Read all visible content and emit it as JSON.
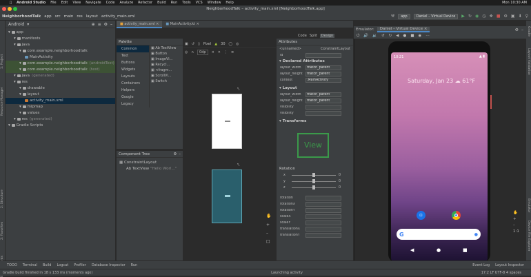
{
  "macbar": {
    "app": "Android Studio",
    "menus": [
      "File",
      "Edit",
      "View",
      "Navigate",
      "Code",
      "Analyze",
      "Refactor",
      "Build",
      "Run",
      "Tools",
      "VCS",
      "Window",
      "Help"
    ],
    "clock": "Mon 10:30 AM"
  },
  "window_title": "NeighborhoodTalk – activity_main.xml [NeighborhoodTalk.app]",
  "breadcrumbs": [
    "NeighborhoodTalk",
    "app",
    "src",
    "main",
    "res",
    "layout",
    "activity_main.xml"
  ],
  "toolbar": {
    "module": "app",
    "device": "Daniel – Virtual Device"
  },
  "left_strip": [
    "1: Project",
    "Resource Manager",
    "2: Structure",
    "2: Favorites",
    "Build Variants"
  ],
  "right_strip": [
    "Gradle",
    "Layout Validation",
    "Emulator",
    "Device File Explorer"
  ],
  "project": {
    "view": "Android",
    "tree": [
      {
        "label": "app",
        "indent": 0,
        "icon": "folder",
        "state": "normal"
      },
      {
        "label": "manifests",
        "indent": 1,
        "icon": "folder",
        "state": "normal"
      },
      {
        "label": "java",
        "indent": 1,
        "icon": "folder",
        "state": "normal"
      },
      {
        "label": "com.example.neighborhoodtalk",
        "indent": 2,
        "icon": "folder",
        "state": "normal"
      },
      {
        "label": "MainActivity",
        "indent": 3,
        "icon": "class",
        "state": "normal"
      },
      {
        "label": "com.example.neighborhoodtalk",
        "suffix": "(androidTest)",
        "indent": 2,
        "icon": "folder",
        "state": "hl"
      },
      {
        "label": "com.example.neighborhoodtalk",
        "suffix": "(test)",
        "indent": 2,
        "icon": "folder",
        "state": "hl"
      },
      {
        "label": "java",
        "suffix": "(generated)",
        "indent": 1,
        "icon": "folder",
        "state": "normal"
      },
      {
        "label": "res",
        "indent": 1,
        "icon": "folder",
        "state": "normal"
      },
      {
        "label": "drawable",
        "indent": 2,
        "icon": "folder",
        "state": "normal"
      },
      {
        "label": "layout",
        "indent": 2,
        "icon": "folder",
        "state": "normal"
      },
      {
        "label": "activity_main.xml",
        "indent": 3,
        "icon": "xml",
        "state": "sel"
      },
      {
        "label": "mipmap",
        "indent": 2,
        "icon": "folder",
        "state": "normal"
      },
      {
        "label": "values",
        "indent": 2,
        "icon": "folder",
        "state": "normal"
      },
      {
        "label": "res",
        "suffix": "(generated)",
        "indent": 1,
        "icon": "folder",
        "state": "normal"
      },
      {
        "label": "Gradle Scripts",
        "indent": 0,
        "icon": "folder",
        "state": "normal"
      }
    ]
  },
  "editor_tabs": [
    "activity_main.xml",
    "MainActivity.kt"
  ],
  "view_modes": [
    "Code",
    "Split",
    "Design"
  ],
  "design_toolbar": {
    "device": "Pixel",
    "api": "30"
  },
  "palette": {
    "title": "Palette",
    "categories": [
      "Common",
      "Text",
      "Buttons",
      "Widgets",
      "Layouts",
      "Containers",
      "Helpers",
      "Google",
      "Legacy"
    ],
    "items": [
      "Ab TextView",
      "Button",
      "ImageVi...",
      "Recycl...",
      "<fragm...",
      "ScrollVi...",
      "Switch"
    ]
  },
  "component_tree": {
    "title": "Component Tree",
    "root": "ConstraintLayout",
    "child": "Ab TextView",
    "child_value": "\"Hello Worl...\""
  },
  "attributes": {
    "title": "Attributes",
    "id_label": "id",
    "header_left": "<unnamed>",
    "header_right": "ConstraintLayout",
    "declared_title": "Declared Attributes",
    "declared": [
      [
        "layout_width",
        "match_parent"
      ],
      [
        "layout_height",
        "match_parent"
      ],
      [
        "context",
        ".MainActivity"
      ]
    ],
    "layout_title": "Layout",
    "layout": [
      [
        "layout_width",
        "match_parent"
      ],
      [
        "layout_height",
        "match_parent"
      ],
      [
        "visibility",
        ""
      ],
      [
        "visibility",
        ""
      ]
    ],
    "transforms_title": "Transforms",
    "view_box": "View",
    "rotation_label": "Rotation",
    "rotation": [
      [
        "x",
        "0"
      ],
      [
        "y",
        "0"
      ],
      [
        "z",
        "0"
      ]
    ],
    "props": [
      "rotation",
      "rotationX",
      "rotationY",
      "scaleX",
      "scaleY",
      "translationX",
      "translationY"
    ]
  },
  "emulator": {
    "label": "Emulator:",
    "device": "Daniel – Virtual Device",
    "time": "10:21",
    "date": "Saturday, Jan 23",
    "temp": "61°F",
    "search_g": "G"
  },
  "bottom_tabs": [
    "TODO",
    "Terminal",
    "Build",
    "Logcat",
    "Profiler",
    "Database Inspector",
    "Run"
  ],
  "bottom_right": [
    "Event Log",
    "Layout Inspector"
  ],
  "status": {
    "left": "Gradle build finished in 18 s 133 ms (moments ago)",
    "center": "Launching activity",
    "right": "17:2   LF   UTF-8   4 spaces"
  }
}
